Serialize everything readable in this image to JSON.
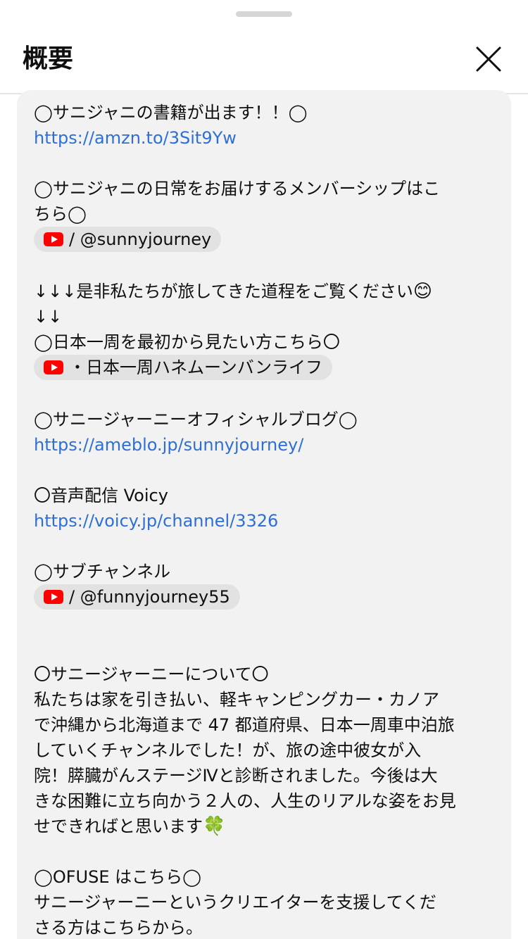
{
  "header": {
    "title": "概要",
    "close_icon": "close-icon"
  },
  "description": {
    "book_heading": "◯サニジャニの書籍が出ます！！◯",
    "book_link": "https://amzn.to/3Sit9Yw",
    "membership_heading_1": "◯サニジャニの日常をお届けするメンバーシップはこ",
    "membership_heading_2": "ちら◯",
    "membership_chip": "/ @sunnyjourney",
    "journey_line_1": "↓↓↓是非私たちが旅してきた道程をご覧ください",
    "journey_emoji": "😊",
    "journey_line_2": "↓↓",
    "japan_heading": "◯日本一周を最初から見たい方こちら〇",
    "japan_chip": "・日本一周ハネムーンバンライフ",
    "blog_heading": "◯サニージャーニーオフィシャルブログ◯",
    "blog_link": "https://ameblo.jp/sunnyjourney/",
    "voicy_heading": "〇音声配信 Voicy",
    "voicy_link": "https://voicy.jp/channel/3326",
    "sub_heading": "◯サブチャンネル",
    "sub_chip": "/ @funnyjourney55",
    "about_heading": "〇サニージャーニーについて〇",
    "about_1": "私たちは家を引き払い、軽キャンピングカー・カノア",
    "about_2": "で沖縄から北海道まで 47 都道府県、日本一周車中泊旅",
    "about_3": "していくチャンネルでした！が、旅の途中彼女が入",
    "about_4": "院！膵臓がんステージⅣと診断されました。今後は大",
    "about_5": "きな困難に立ち向かう２人の、人生のリアルな姿をお見",
    "about_6": "せできればと思います",
    "about_emoji": "🍀",
    "ofuse_heading": "◯OFUSE はこちら◯",
    "ofuse_1": "サニージャーニーというクリエイターを支援してくだ",
    "ofuse_2": "さる方はこちらから。"
  },
  "icons": {
    "youtube": "youtube-icon",
    "accent_link_color": "#2e6fd6",
    "youtube_red": "#ff0000"
  }
}
